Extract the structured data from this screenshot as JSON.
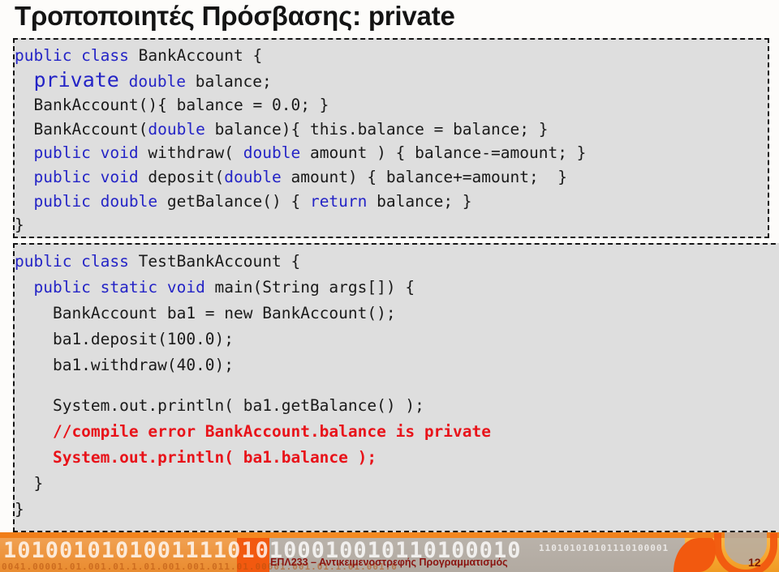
{
  "slide": {
    "title": "Τροποποιητές Πρόσβασης: private",
    "colors": {
      "keyword_blue": "#2424c6",
      "error_red": "#e8131a",
      "code_background": "#dedede",
      "accent_orange": "#f2590f",
      "footer_text": "#8a1410"
    }
  },
  "code_block_1": {
    "lines": [
      {
        "segments": [
          {
            "t": "public class ",
            "c": "kw"
          },
          {
            "t": "BankAccount {",
            "c": "plain"
          }
        ]
      },
      {
        "segments": [
          {
            "t": "  ",
            "c": "plain"
          },
          {
            "t": "private",
            "c": "big"
          },
          {
            "t": " ",
            "c": "plain"
          },
          {
            "t": "double",
            "c": "kw"
          },
          {
            "t": " balance;",
            "c": "plain"
          }
        ]
      },
      {
        "segments": [
          {
            "t": "  BankAccount(){ balance = 0.0; }",
            "c": "plain"
          }
        ]
      },
      {
        "segments": [
          {
            "t": "  BankAccount(",
            "c": "plain"
          },
          {
            "t": "double",
            "c": "kw"
          },
          {
            "t": " balance){ this.balance = balance; }",
            "c": "plain"
          }
        ]
      },
      {
        "segments": [
          {
            "t": "  ",
            "c": "plain"
          },
          {
            "t": "public void",
            "c": "kw"
          },
          {
            "t": " withdraw( ",
            "c": "plain"
          },
          {
            "t": "double",
            "c": "kw"
          },
          {
            "t": " amount ) { balance-=amount; }",
            "c": "plain"
          }
        ]
      },
      {
        "segments": [
          {
            "t": "  ",
            "c": "plain"
          },
          {
            "t": "public void",
            "c": "kw"
          },
          {
            "t": " deposit(",
            "c": "plain"
          },
          {
            "t": "double",
            "c": "kw"
          },
          {
            "t": " amount) { balance+=amount;  }",
            "c": "plain"
          }
        ]
      },
      {
        "segments": [
          {
            "t": "  ",
            "c": "plain"
          },
          {
            "t": "public double",
            "c": "kw"
          },
          {
            "t": " getBalance() { ",
            "c": "plain"
          },
          {
            "t": "return",
            "c": "kw"
          },
          {
            "t": " balance; }",
            "c": "plain"
          }
        ]
      },
      {
        "segments": [
          {
            "t": "}",
            "c": "plain"
          }
        ]
      }
    ]
  },
  "code_block_2": {
    "lines": [
      {
        "segments": [
          {
            "t": "public class ",
            "c": "kw"
          },
          {
            "t": "TestBankAccount {",
            "c": "plain"
          }
        ]
      },
      {
        "segments": [
          {
            "t": "  ",
            "c": "plain"
          },
          {
            "t": "public static void",
            "c": "kw"
          },
          {
            "t": " main(String args[]) {",
            "c": "plain"
          }
        ]
      },
      {
        "segments": [
          {
            "t": "    BankAccount ba1 = new BankAccount();",
            "c": "plain"
          }
        ]
      },
      {
        "segments": [
          {
            "t": "    ba1.deposit(100.0);",
            "c": "plain"
          }
        ]
      },
      {
        "segments": [
          {
            "t": "    ba1.withdraw(40.0);",
            "c": "plain"
          }
        ]
      },
      {
        "segments": [
          {
            "t": "",
            "c": "spacer"
          }
        ]
      },
      {
        "segments": [
          {
            "t": "    System.out.println( ba1.getBalance() );",
            "c": "plain"
          }
        ]
      },
      {
        "segments": [
          {
            "t": "    //compile error BankAccount.balance is private",
            "c": "err"
          }
        ]
      },
      {
        "segments": [
          {
            "t": "    System.out.println( ba1.balance );",
            "c": "err"
          }
        ]
      },
      {
        "segments": [
          {
            "t": "  }",
            "c": "plain"
          }
        ]
      },
      {
        "segments": [
          {
            "t": "}",
            "c": "plain"
          }
        ]
      }
    ]
  },
  "footer": {
    "course": "ΕΠΛ233 – Αντικειμενοστρεφής Προγραμματισμός",
    "page_number": "12",
    "binary_large": "1010010101001111010100010010110100010",
    "binary_small": "0041.00001.01.001.01.1.01.001.001.011.01.00001.001.01.1.01.001.0",
    "binary_tiny": "110101010101110100001"
  }
}
